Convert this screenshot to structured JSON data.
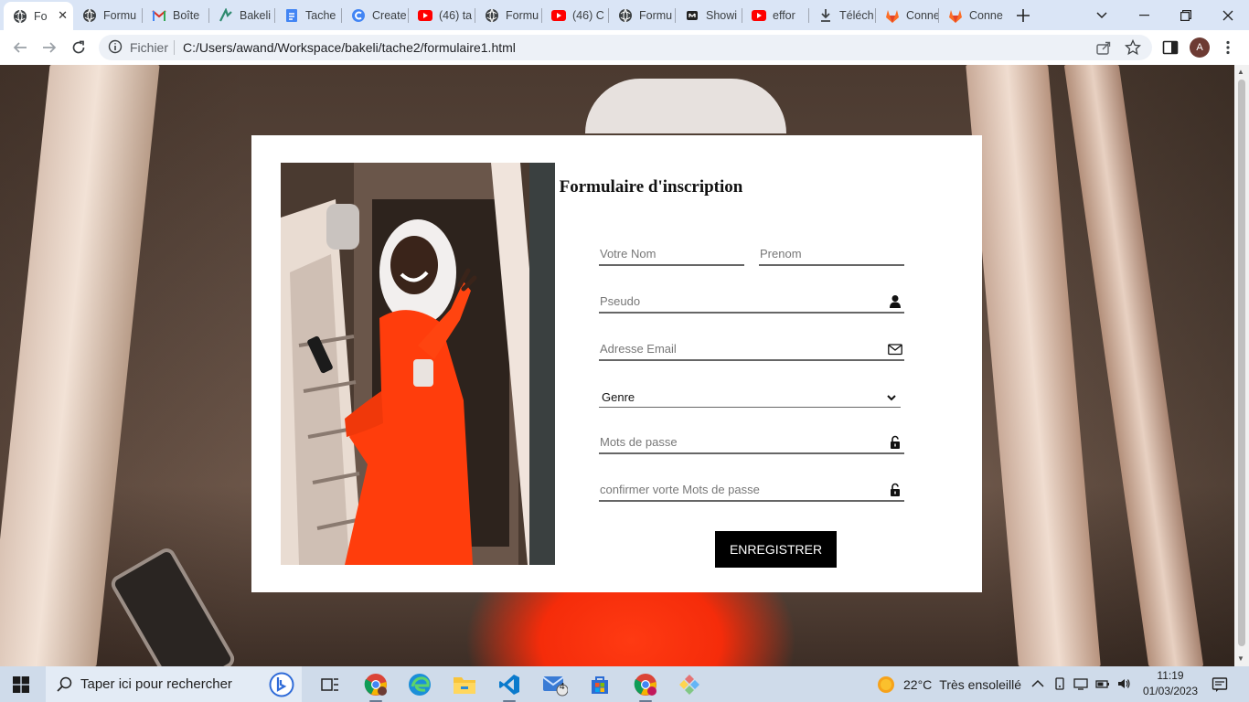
{
  "browser": {
    "tabs": [
      {
        "title": "Fo",
        "active": true,
        "icon": "globe-icon"
      },
      {
        "title": "Formu",
        "icon": "globe-icon"
      },
      {
        "title": "Boîte",
        "icon": "gmail-icon"
      },
      {
        "title": "Bakeli",
        "icon": "bakeli-icon"
      },
      {
        "title": "Tache",
        "icon": "docs-icon"
      },
      {
        "title": "Create",
        "icon": "canva-icon"
      },
      {
        "title": "(46) ta",
        "icon": "youtube-icon"
      },
      {
        "title": "Formu",
        "icon": "globe-icon"
      },
      {
        "title": "(46) C",
        "icon": "youtube-icon"
      },
      {
        "title": "Formu",
        "icon": "globe-icon"
      },
      {
        "title": "Showi",
        "icon": "github-icon"
      },
      {
        "title": "effor",
        "icon": "youtube-icon"
      },
      {
        "title": "Téléch",
        "icon": "download-icon"
      },
      {
        "title": "Conne",
        "icon": "gitlab-icon"
      },
      {
        "title": "Conne",
        "icon": "gitlab-icon"
      }
    ],
    "address": {
      "scheme_label": "Fichier",
      "url": "C:/Users/awand/Workspace/bakeli/tache2/formulaire1.html"
    },
    "profile_initial": "A"
  },
  "form": {
    "title": "Formulaire d'inscription",
    "nom_placeholder": "Votre Nom",
    "prenom_placeholder": "Prenom",
    "pseudo_placeholder": "Pseudo",
    "email_placeholder": "Adresse Email",
    "genre_value": "Genre",
    "password_placeholder": "Mots de passe",
    "confirm_placeholder": "confirmer vorte Mots de passe",
    "submit_label": "ENREGISTRER"
  },
  "taskbar": {
    "search_placeholder": "Taper ici pour rechercher",
    "weather_temp": "22°C",
    "weather_text": "Très ensoleillé",
    "time": "11:19",
    "date": "01/03/2023",
    "mail_badge": "4"
  },
  "colors": {
    "accent_button": "#000000",
    "tabstrip": "#dae5f6",
    "taskbar": "#cfdbea"
  }
}
